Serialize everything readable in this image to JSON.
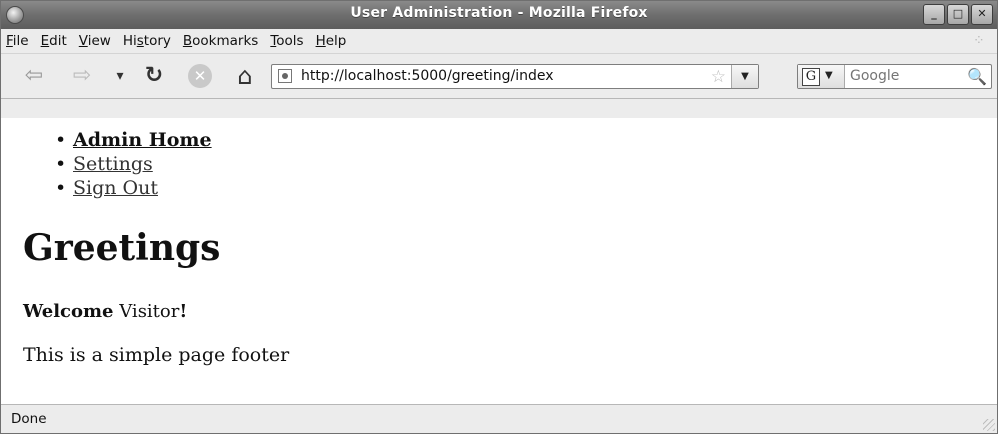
{
  "window": {
    "title": "User Administration - Mozilla Firefox",
    "minimize_glyph": "_",
    "maximize_glyph": "□",
    "close_glyph": "✕"
  },
  "menubar": {
    "items": [
      "File",
      "Edit",
      "View",
      "History",
      "Bookmarks",
      "Tools",
      "Help"
    ],
    "access_keys": [
      "F",
      "E",
      "V",
      "s",
      "B",
      "T",
      "H"
    ]
  },
  "toolbar": {
    "back_glyph": "⇦",
    "forward_glyph": "⇨",
    "history_glyph": "▾",
    "reload_glyph": "↻",
    "stop_glyph": "✕",
    "home_glyph": "⌂",
    "url": "http://localhost:5000/greeting/index",
    "bookmark_star_glyph": "☆",
    "url_dropdown_glyph": "▼",
    "search_engine_letter": "G",
    "search_engine_caret": "▼",
    "search_placeholder": "Google",
    "search_glyph": "🔍"
  },
  "page": {
    "nav_links": [
      {
        "label": "Admin Home"
      },
      {
        "label": "Settings"
      },
      {
        "label": "Sign Out"
      }
    ],
    "heading": "Greetings",
    "welcome_bold": "Welcome",
    "welcome_name": "Visitor",
    "welcome_end": "!",
    "footer": "This is a simple page footer"
  },
  "status": {
    "text": "Done"
  },
  "colors": {
    "titlebar": "#6e6e6e",
    "chrome": "#ececec",
    "page_bg": "#ffffff",
    "link": "#333333"
  }
}
